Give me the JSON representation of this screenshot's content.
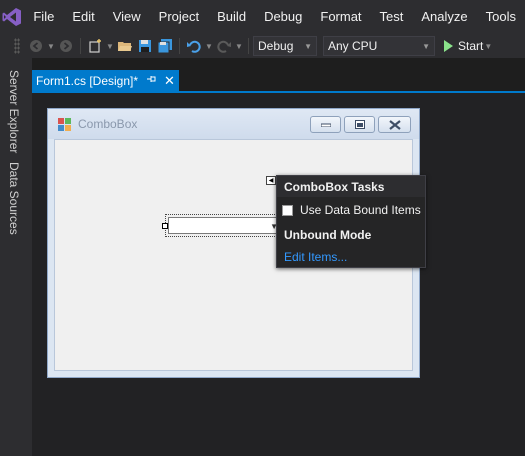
{
  "menu": {
    "items": [
      "File",
      "Edit",
      "View",
      "Project",
      "Build",
      "Debug",
      "Format",
      "Test",
      "Analyze",
      "Tools"
    ]
  },
  "toolbar": {
    "config": "Debug",
    "platform": "Any CPU",
    "start_label": "Start"
  },
  "sidebar": {
    "tabs": [
      "Server Explorer",
      "Data Sources"
    ]
  },
  "document_tab": {
    "title": "Form1.cs [Design]*"
  },
  "form": {
    "title": "ComboBox"
  },
  "tasks_panel": {
    "header": "ComboBox Tasks",
    "checkbox_label": "Use Data Bound Items",
    "checked": false,
    "section": "Unbound Mode",
    "link": "Edit Items..."
  },
  "colors": {
    "accent": "#007acc",
    "chrome": "#2d2d30",
    "editor_bg": "#1e1e1e",
    "link": "#3399ff",
    "start_green": "#8ae28a"
  }
}
